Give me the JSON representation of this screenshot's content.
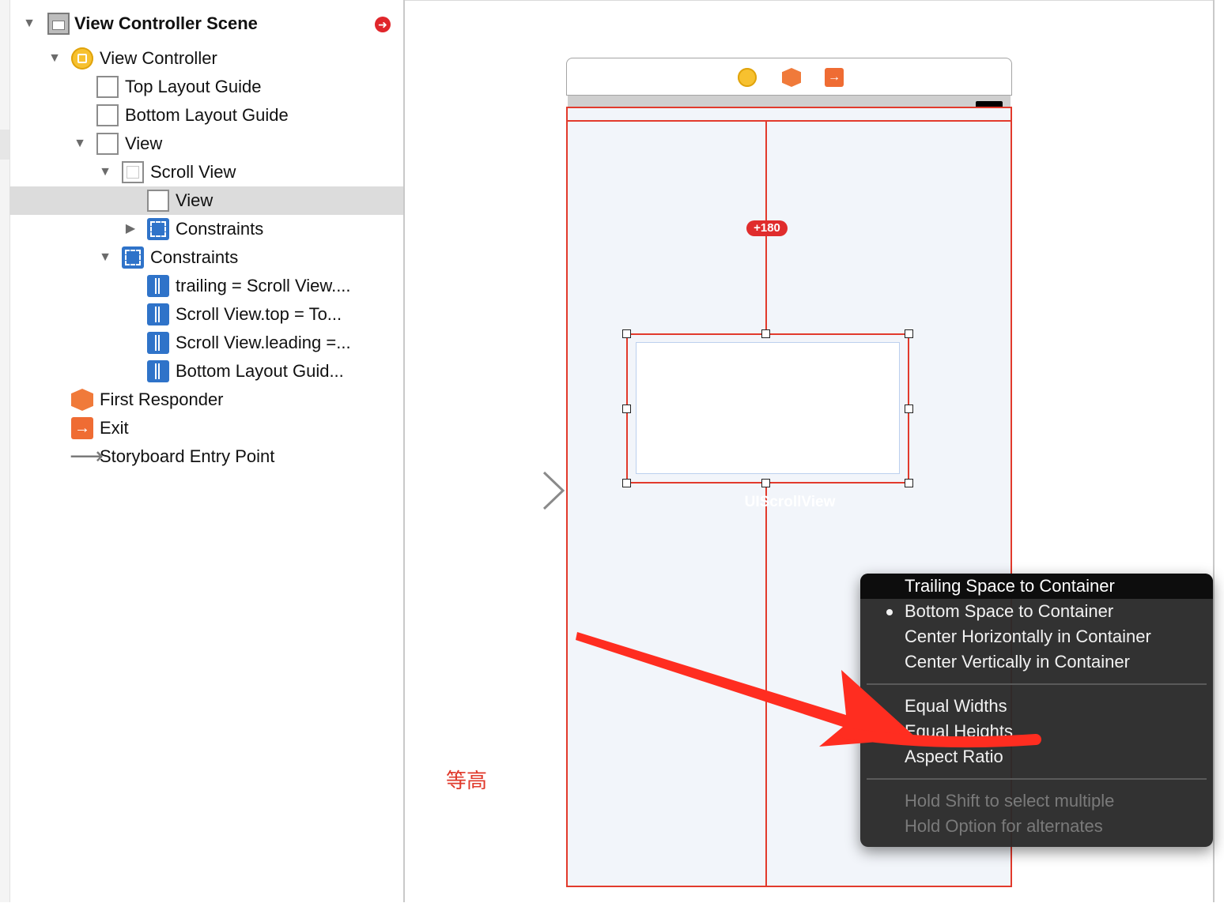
{
  "outline": {
    "items": [
      {
        "label": "View Controller Scene",
        "bold": true
      },
      {
        "label": "View Controller"
      },
      {
        "label": "Top Layout Guide"
      },
      {
        "label": "Bottom Layout Guide"
      },
      {
        "label": "View"
      },
      {
        "label": "Scroll View"
      },
      {
        "label": "View",
        "selected": true
      },
      {
        "label": "Constraints"
      },
      {
        "label": "Constraints"
      },
      {
        "label": "trailing = Scroll View...."
      },
      {
        "label": "Scroll View.top = To..."
      },
      {
        "label": "Scroll View.leading =..."
      },
      {
        "label": "Bottom Layout Guid..."
      },
      {
        "label": "First Responder"
      },
      {
        "label": "Exit"
      },
      {
        "label": "Storyboard Entry Point"
      }
    ]
  },
  "canvas": {
    "constraint_badge": "+180",
    "scroll_view_label": "UIScrollView",
    "annotation": "等高"
  },
  "menu": {
    "items": [
      {
        "label": "Trailing Space to Container",
        "highlighted": true
      },
      {
        "label": "Bottom Space to Container",
        "checked": true
      },
      {
        "label": "Center Horizontally in Container"
      },
      {
        "label": "Center Vertically in Container"
      },
      {
        "label": "Equal Widths"
      },
      {
        "label": "Equal Heights"
      },
      {
        "label": "Aspect Ratio"
      },
      {
        "label": "Hold Shift to select multiple",
        "disabled": true
      },
      {
        "label": "Hold Option for alternates",
        "disabled": true
      }
    ]
  },
  "colors": {
    "constraint_red": "#e23a2c",
    "selection_gray": "#dcdcdc",
    "menu_bg": "#2a2a2a",
    "constraint_blue": "#2f73c9",
    "vc_yellow": "#f7c12f"
  }
}
